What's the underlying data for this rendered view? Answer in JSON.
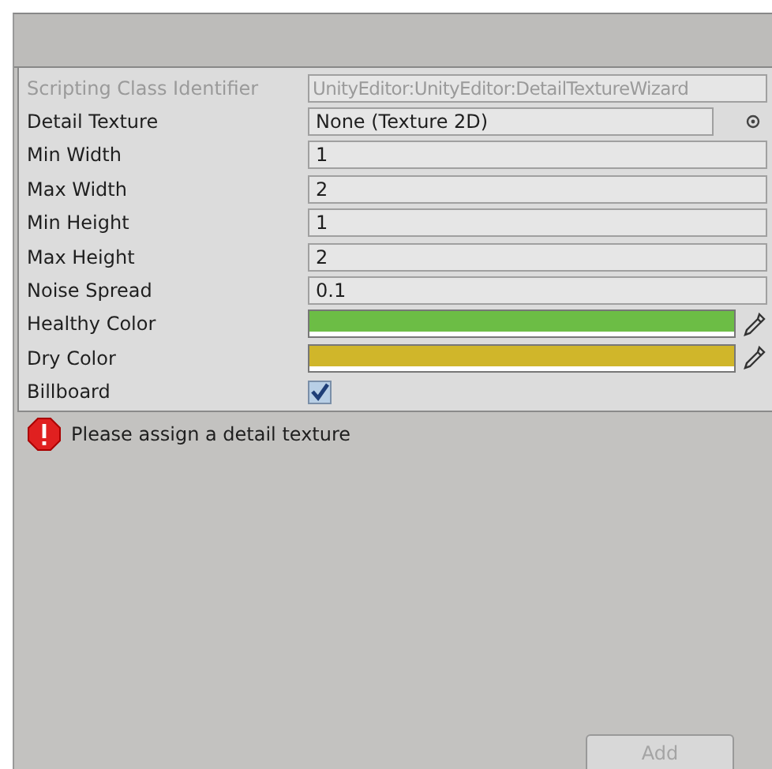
{
  "properties": [
    {
      "label": "Scripting Class Identifier",
      "kind": "text",
      "value": "UnityEditor:UnityEditor:DetailTextureWizard",
      "disabled": true
    },
    {
      "label": "Detail Texture",
      "kind": "object",
      "value": "None (Texture 2D)",
      "disabled": false
    },
    {
      "label": "Min Width",
      "kind": "text",
      "value": "1",
      "disabled": false
    },
    {
      "label": "Max Width",
      "kind": "text",
      "value": "2",
      "disabled": false
    },
    {
      "label": "Min Height",
      "kind": "text",
      "value": "1",
      "disabled": false
    },
    {
      "label": "Max Height",
      "kind": "text",
      "value": "2",
      "disabled": false
    },
    {
      "label": "Noise Spread",
      "kind": "text",
      "value": "0.1",
      "disabled": false
    },
    {
      "label": "Healthy Color",
      "kind": "color",
      "color": "#6cbd45",
      "disabled": false
    },
    {
      "label": "Dry Color",
      "kind": "color",
      "color": "#d0b62a",
      "disabled": false
    },
    {
      "label": "Billboard",
      "kind": "checkbox",
      "checked": true,
      "disabled": false
    }
  ],
  "message": {
    "text": "Please assign a detail texture"
  },
  "add_button": {
    "label": "Add",
    "disabled": true
  }
}
